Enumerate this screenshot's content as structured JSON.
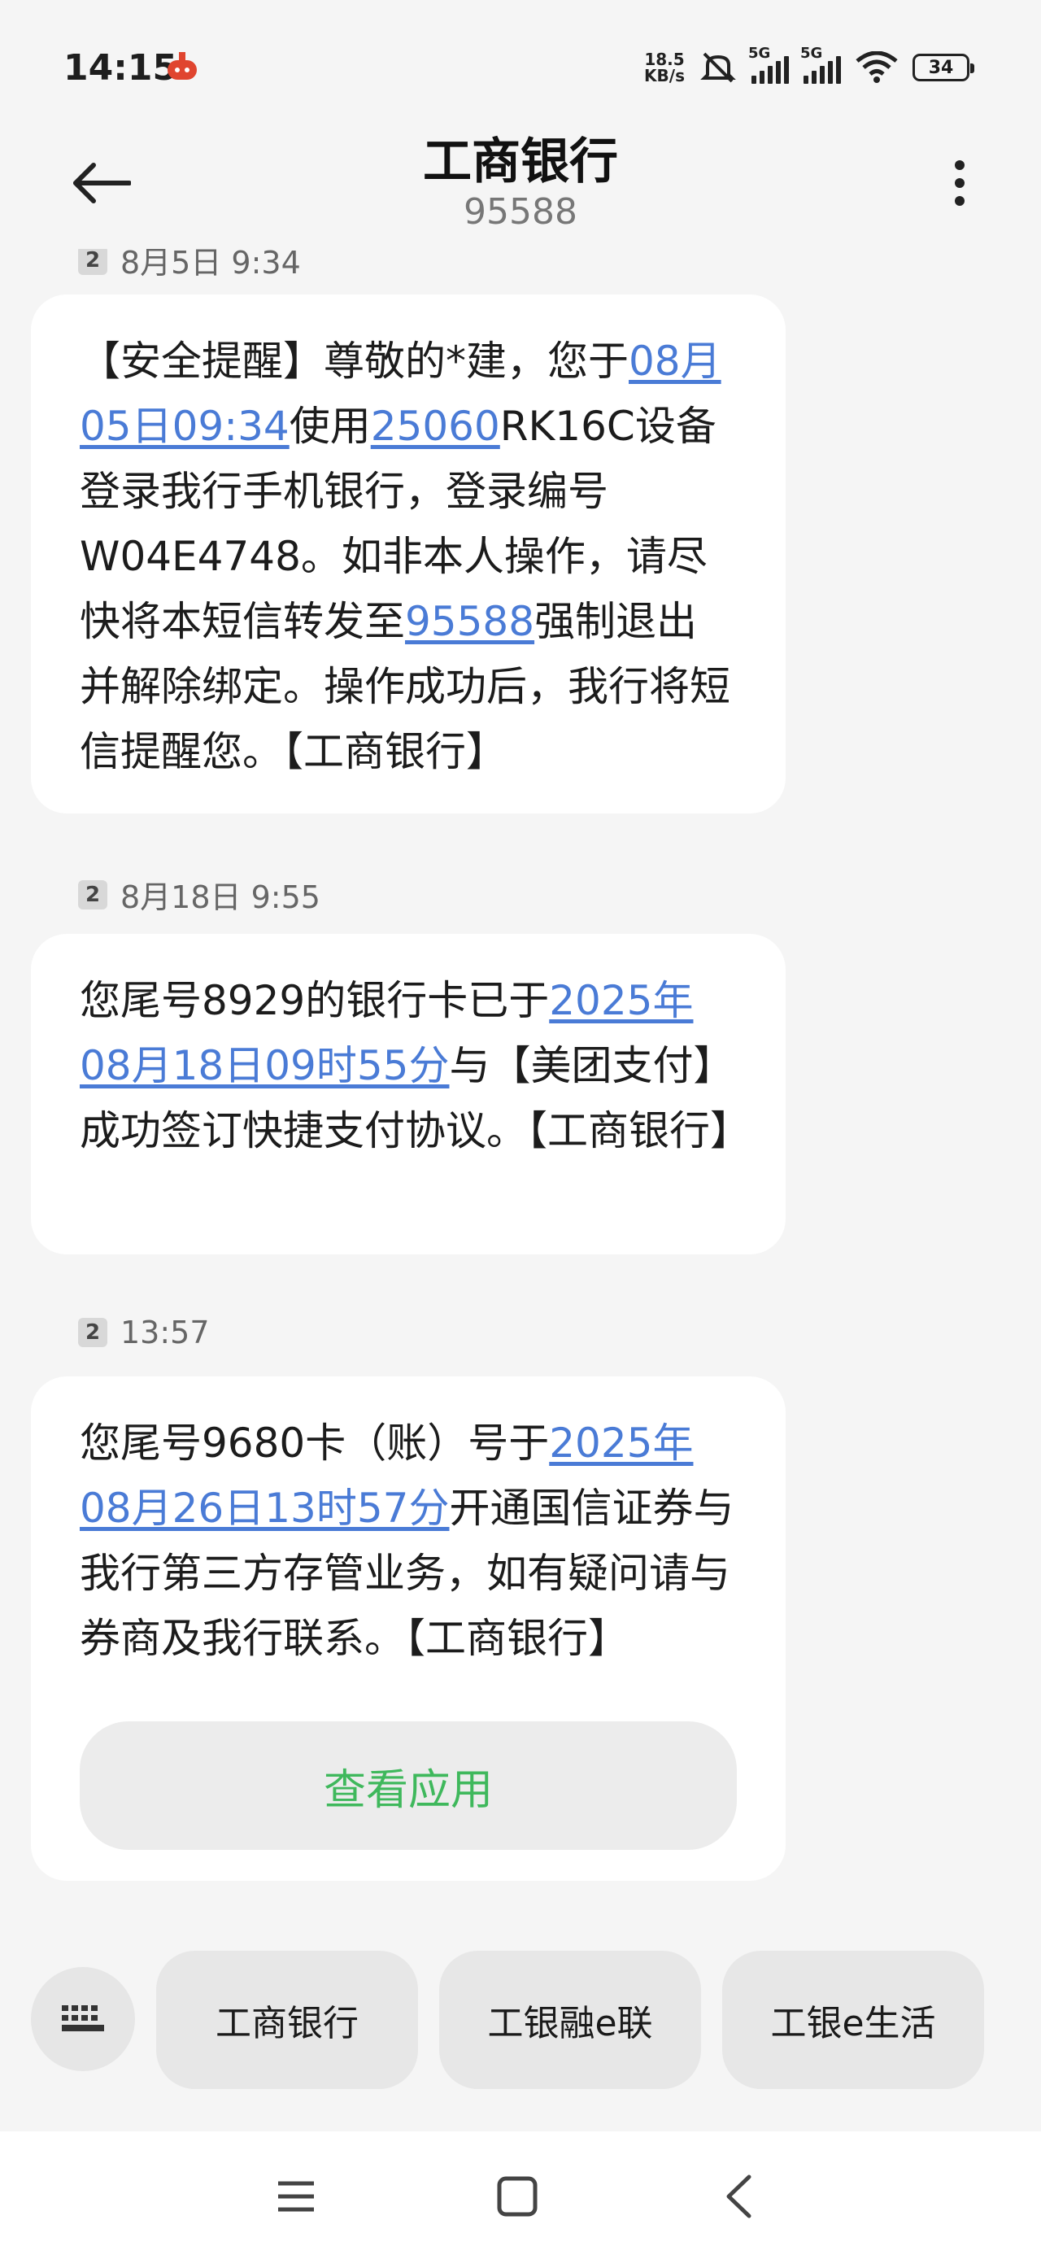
{
  "status_bar": {
    "time": "14:15",
    "speed_value": "18.5",
    "speed_unit": "KB/s",
    "sig1_tag": "5G",
    "sig2_tag": "5G",
    "battery": "34"
  },
  "header": {
    "title": "工商银行",
    "subtitle": "95588"
  },
  "messages": [
    {
      "sim": "2",
      "timestamp": "8月5日 9:34",
      "segments": [
        {
          "text": "【安全提醒】尊敬的*建，您于",
          "link": false
        },
        {
          "text": "08月05日09:34",
          "link": true
        },
        {
          "text": "使用",
          "link": false
        },
        {
          "text": "25060",
          "link": true
        },
        {
          "text": "RK16C设备登录我行手机银行，登录编号W04E4748。如非本人操作，请尽快将本短信转发至",
          "link": false
        },
        {
          "text": "95588",
          "link": true
        },
        {
          "text": "强制退出并解除绑定。操作成功后，我行将短信提醒您。【工商银行】",
          "link": false
        }
      ]
    },
    {
      "sim": "2",
      "timestamp": "8月18日 9:55",
      "segments": [
        {
          "text": "您尾号8929的银行卡已于",
          "link": false
        },
        {
          "text": "2025年08月18日09时55分",
          "link": true
        },
        {
          "text": "与【美团支付】成功签订快捷支付协议。【工商银行】",
          "link": false
        }
      ]
    },
    {
      "sim": "2",
      "timestamp": "13:57",
      "segments": [
        {
          "text": "您尾号9680卡（账）号于",
          "link": false
        },
        {
          "text": "2025年08月26日13时57分",
          "link": true
        },
        {
          "text": "开通国信证券与我行第三方存管业务，如有疑问请与券商及我行联系。【工商银行】",
          "link": false
        }
      ],
      "action_label": "查看应用"
    }
  ],
  "quick_replies": [
    "工商银行",
    "工银融e联",
    "工银e生活"
  ],
  "icons": {
    "back": "arrow-left-icon",
    "menu": "more-vertical-icon",
    "keyboard": "keyboard-icon",
    "nav_menu": "menu-lines-icon",
    "nav_home": "square-home-icon",
    "nav_back": "chevron-left-icon"
  },
  "colors": {
    "link": "#4a7bd6",
    "action": "#3fb85c",
    "background": "#f5f5f5"
  }
}
